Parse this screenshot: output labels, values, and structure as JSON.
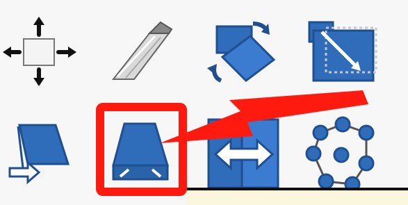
{
  "toolbox": {
    "tools": [
      {
        "icon": "move-icon"
      },
      {
        "icon": "pen-nib-icon"
      },
      {
        "icon": "rotate-icon"
      },
      {
        "icon": "scale-icon"
      },
      {
        "icon": "shear-icon"
      },
      {
        "icon": "perspective-icon"
      },
      {
        "icon": "flip-icon"
      },
      {
        "icon": "cage-transform-icon"
      }
    ],
    "highlighted_tool": "perspective-icon"
  },
  "colors": {
    "icon_blue": "#2f6dbb",
    "icon_dark": "#1f4f8f",
    "highlight_red": "#ff1a0f",
    "background": "#f7f7f7"
  }
}
